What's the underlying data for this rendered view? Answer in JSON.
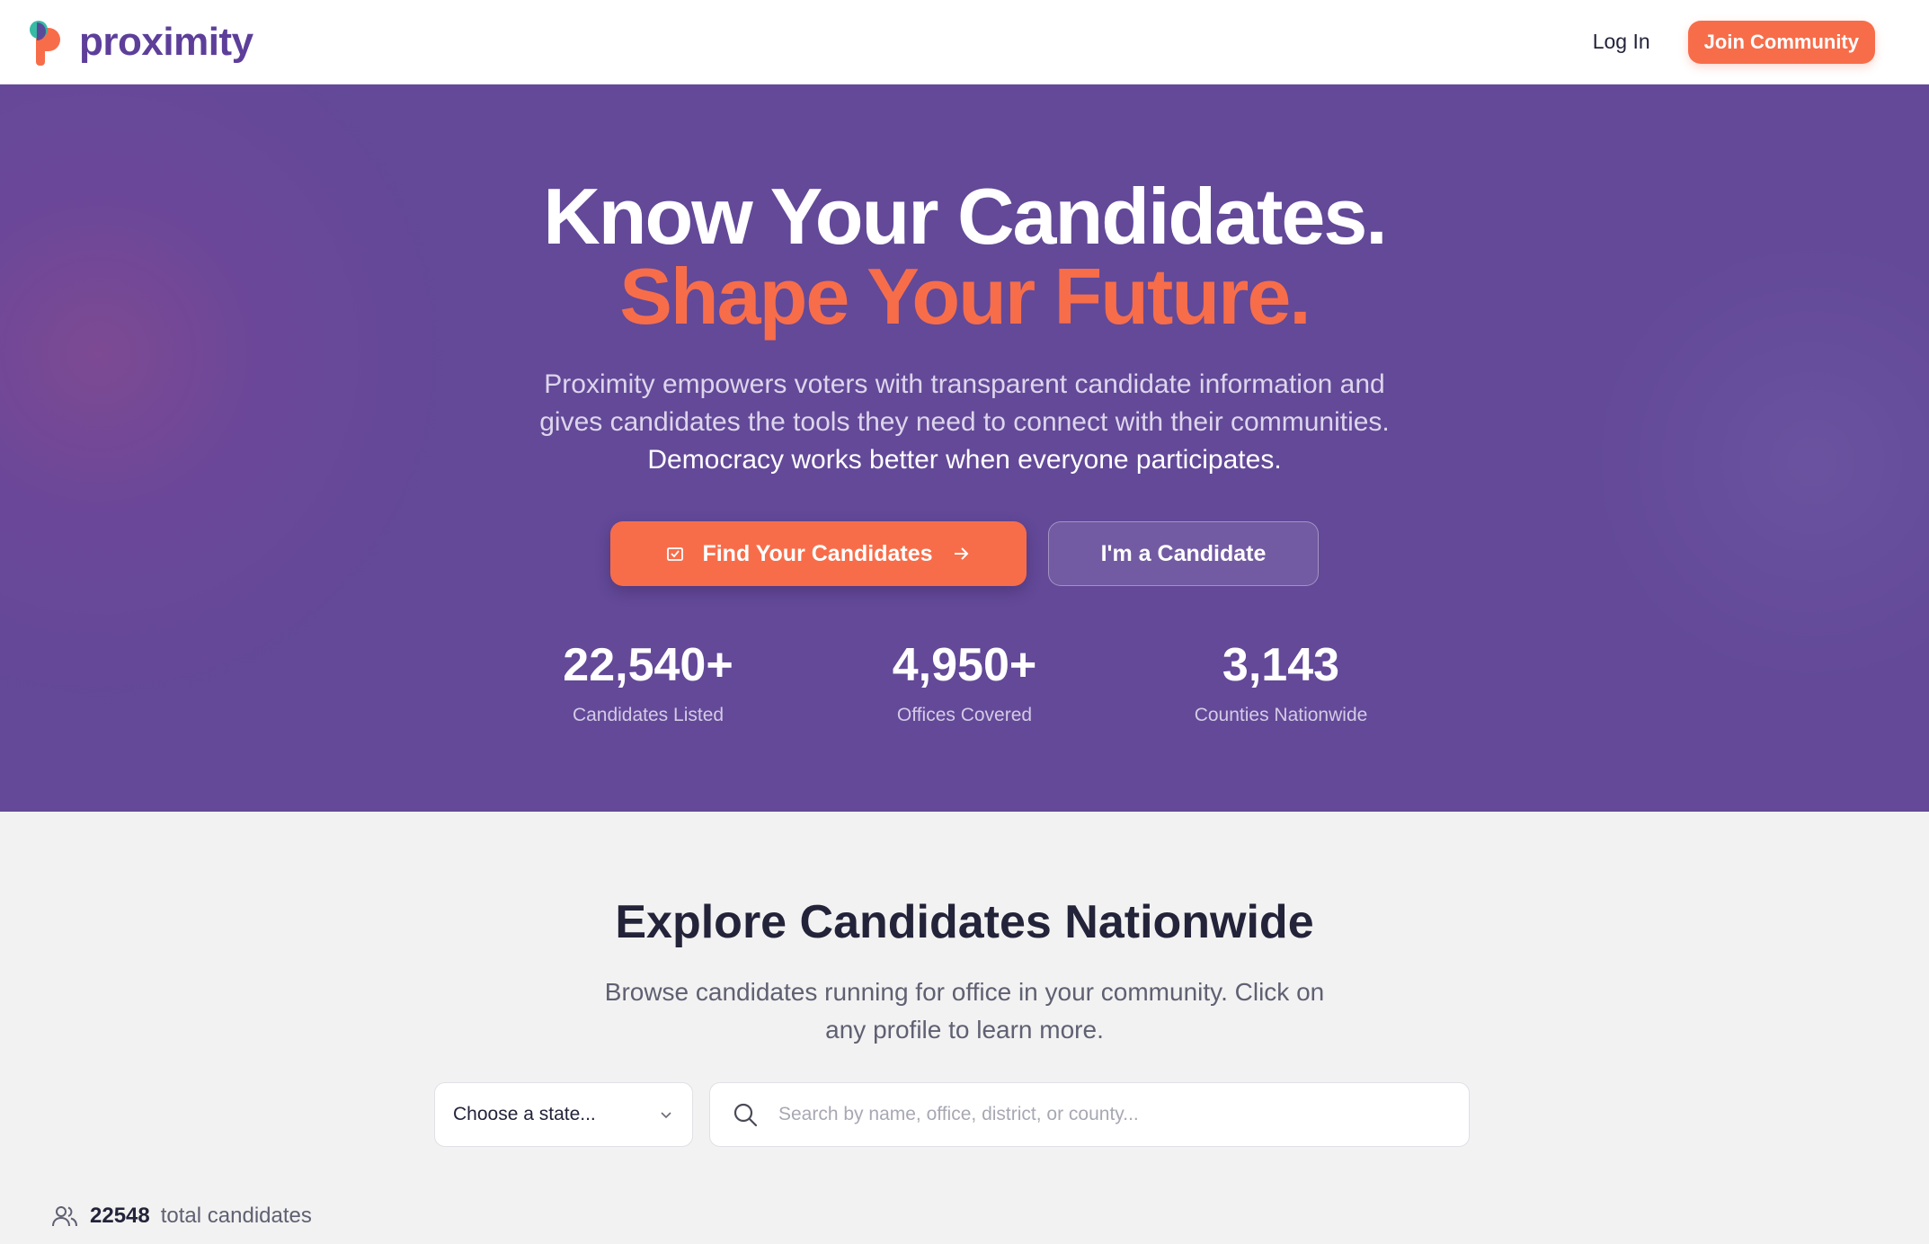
{
  "brand": {
    "name": "proximity"
  },
  "nav": {
    "login_label": "Log In",
    "join_label": "Join Community"
  },
  "hero": {
    "title_line1": "Know Your Candidates.",
    "title_line2": "Shape Your Future.",
    "subtitle_line1": "Proximity empowers voters with transparent candidate information and",
    "subtitle_line2": "gives candidates the tools they need to connect with their communities.",
    "subtitle_line3": "Democracy works better when everyone participates.",
    "primary_cta": "Find Your Candidates",
    "secondary_cta": "I'm a Candidate",
    "stats": [
      {
        "value": "22,540+",
        "label": "Candidates Listed"
      },
      {
        "value": "4,950+",
        "label": "Offices Covered"
      },
      {
        "value": "3,143",
        "label": "Counties Nationwide"
      }
    ]
  },
  "explore": {
    "title": "Explore Candidates Nationwide",
    "subtitle_line1": "Browse candidates running for office in your community. Click on",
    "subtitle_line2": "any profile to learn more.",
    "state_select_value": "Choose a state...",
    "search_placeholder": "Search by name, office, district, or county...",
    "total_count": "22548",
    "total_label": "total candidates"
  },
  "colors": {
    "accent": "#f76d4a",
    "brand_purple": "#5d3f9a",
    "hero_bg": "#634998"
  },
  "icons": [
    "logo-icon",
    "ballot-icon",
    "arrow-right-icon",
    "chevron-down-icon",
    "search-icon",
    "users-icon"
  ]
}
